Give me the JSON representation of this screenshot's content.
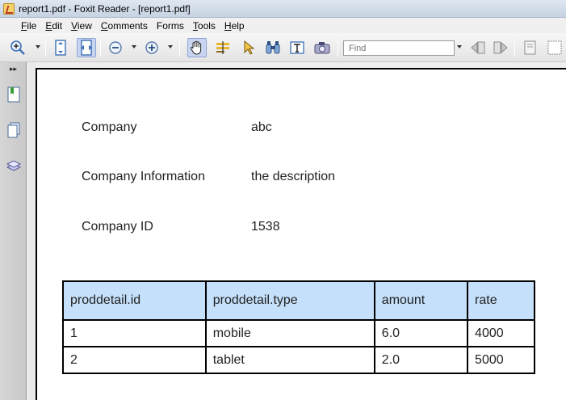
{
  "window": {
    "title": "report1.pdf - Foxit Reader - [report1.pdf]"
  },
  "menu": [
    {
      "ul": "F",
      "rest": "ile"
    },
    {
      "ul": "E",
      "rest": "dit"
    },
    {
      "ul": "V",
      "rest": "iew"
    },
    {
      "ul": "C",
      "rest": "omments"
    },
    {
      "ul": "",
      "rest": "Forms"
    },
    {
      "ul": "T",
      "rest": "ools"
    },
    {
      "ul": "H",
      "rest": "elp"
    }
  ],
  "toolbar": {
    "find_placeholder": "Find",
    "icons": [
      "zoom-in-icon",
      "fit-page-icon",
      "fit-width-icon",
      "zoom-out-icon",
      "zoom-in-plus-icon",
      "hand-tool-icon",
      "text-select-icon",
      "select-arrow-icon",
      "binoculars-icon",
      "typewriter-icon",
      "snapshot-icon",
      "find-previous-icon",
      "find-next-icon",
      "note-icon",
      "blank-page-icon"
    ]
  },
  "document": {
    "fields": [
      {
        "label": "Company",
        "value": "abc"
      },
      {
        "label": "Company Information",
        "value": "the description"
      },
      {
        "label": "Company ID",
        "value": "1538"
      }
    ],
    "table": {
      "headers": [
        "proddetail.id",
        "proddetail.type",
        "amount",
        "rate"
      ],
      "rows": [
        [
          "1",
          "mobile",
          "6.0",
          "4000"
        ],
        [
          "2",
          "tablet",
          "2.0",
          "5000"
        ]
      ]
    }
  },
  "colors": {
    "table_header_bg": "#c4e0fb",
    "toolbar_pressed": "#c9d5f0"
  }
}
